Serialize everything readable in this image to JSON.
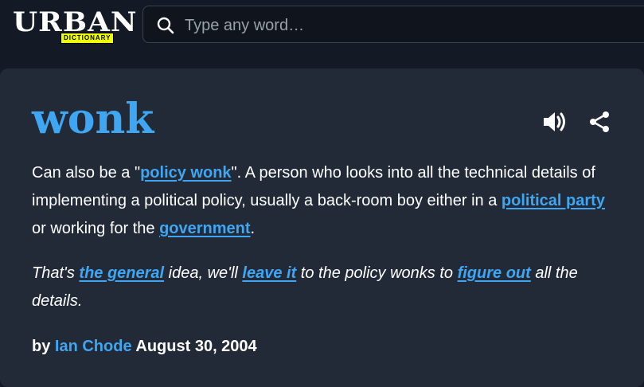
{
  "header": {
    "logo": {
      "word": "URBAN",
      "sub": "DICTIONARY"
    },
    "search": {
      "placeholder": "Type any word…",
      "value": ""
    }
  },
  "entry": {
    "word": "wonk",
    "definition": {
      "t1": "Can also be a \"",
      "link1": "policy wonk",
      "t2": "\". A person who looks into all the technical details of implementing a political policy, usually a back-room boy either in a ",
      "link2": "political party",
      "t3": " or working for the ",
      "link3": "government",
      "t4": "."
    },
    "example": {
      "t1": "That's ",
      "link1": "the general",
      "t2": " idea, we'll ",
      "link2": "leave it",
      "t3": " to the policy wonks to ",
      "link3": "figure out",
      "t4": " all the details."
    },
    "byline": {
      "prefix": "by ",
      "author": "Ian Chode",
      "date": " August 30, 2004"
    },
    "icons": {
      "audio": "speaker-icon",
      "share": "share-icon"
    }
  },
  "colors": {
    "background": "#141a25",
    "card": "#222a38",
    "accent": "#3ea6f2",
    "logo_badge": "#efff00"
  }
}
